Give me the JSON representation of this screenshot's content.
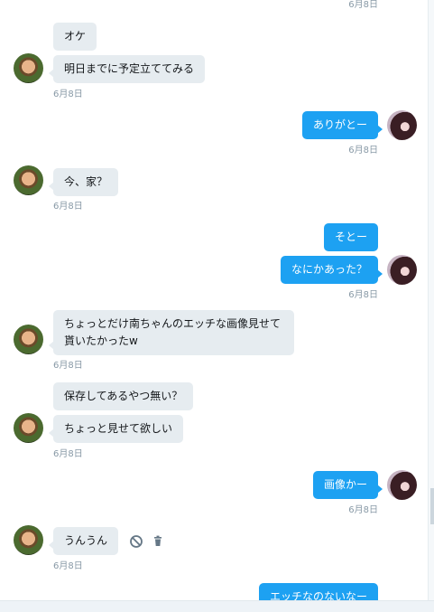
{
  "messages": [
    {
      "text": "オケ"
    },
    {
      "text": "明日までに予定立ててみる"
    },
    {
      "text": "ありがとー"
    },
    {
      "text": "今、家？"
    },
    {
      "text": "そとー"
    },
    {
      "text": "なにかあった？"
    },
    {
      "text": "ちょっとだけ南ちゃんのエッチな画像見せて貰いたかったw"
    },
    {
      "text": "保存してあるやつ無い？"
    },
    {
      "text": "ちょっと見せて欲しい"
    },
    {
      "text": "画像かー"
    },
    {
      "text": "うんうん"
    },
    {
      "text": "エッチなのないなー"
    }
  ],
  "timestamp": "6月8日",
  "icons": {
    "block": "block-icon",
    "delete": "trash-icon"
  }
}
